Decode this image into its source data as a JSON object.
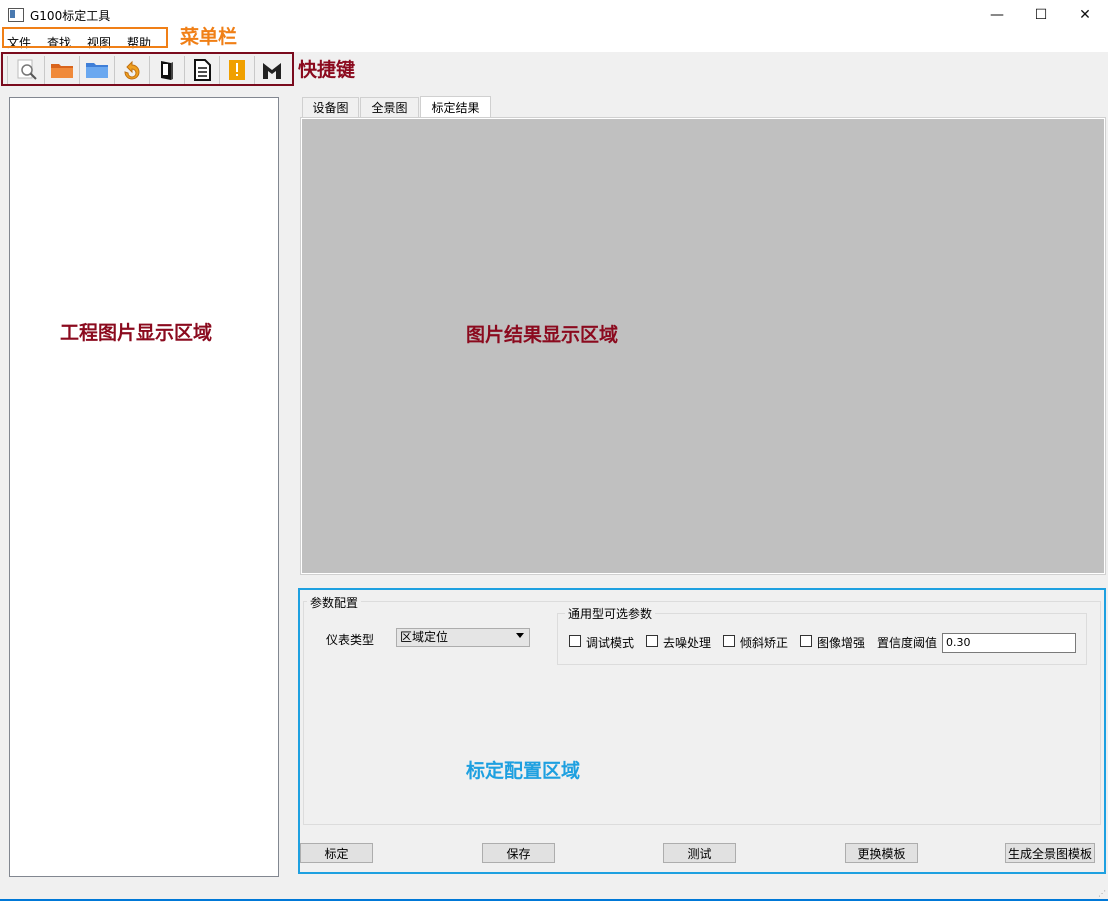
{
  "window": {
    "title": "G100标定工具",
    "minimize": "—",
    "maximize": "☐",
    "close": "✕"
  },
  "menubar": {
    "items": [
      "文件",
      "查找",
      "视图",
      "帮助"
    ],
    "annotation": "菜单栏"
  },
  "toolbar": {
    "annotation": "快捷键",
    "buttons": [
      "search-doc-icon",
      "open-folder-icon",
      "folder-icon",
      "refresh-icon",
      "book-icon",
      "document-icon",
      "exclamation-icon",
      "m-icon"
    ]
  },
  "left_panel": {
    "annotation": "工程图片显示区域"
  },
  "tabs": {
    "items": [
      "设备图",
      "全景图",
      "标定结果"
    ],
    "active": "标定结果"
  },
  "result_area": {
    "annotation": "图片结果显示区域"
  },
  "config": {
    "annotation": "标定配置区域",
    "group_title": "参数配置",
    "meter_type_label": "仪表类型",
    "meter_type_value": "区域定位",
    "optional_group_title": "通用型可选参数",
    "checkboxes": [
      "调试模式",
      "去噪处理",
      "倾斜矫正",
      "图像增强"
    ],
    "threshold_label": "置信度阈值",
    "threshold_value": "0.30",
    "buttons": [
      "标定",
      "保存",
      "测试",
      "更换模板",
      "生成全景图模板"
    ]
  },
  "colors": {
    "menu_box": "#f07f16",
    "toolbar_box": "#7a0b1d",
    "anno_dark_red": "#8b0a1e",
    "anno_orange": "#f07f16",
    "anno_blue": "#1ea0e0",
    "result_bg": "#c0c0c0"
  }
}
